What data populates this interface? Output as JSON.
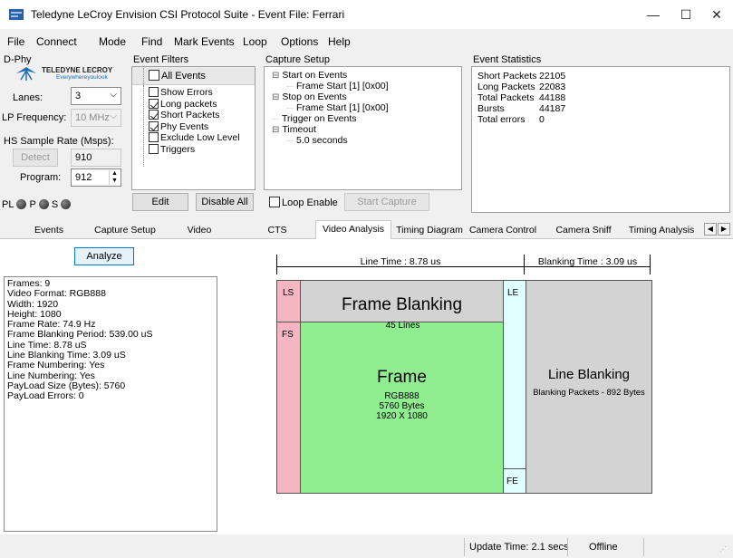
{
  "window": {
    "title": "Teledyne LeCroy Envision CSI Protocol Suite - Event File: Ferrari",
    "minimize": "—",
    "maximize": "☐",
    "close": "✕"
  },
  "menu": [
    "File",
    "Connect",
    "Mode",
    "Find",
    "Mark Events",
    "Loop",
    "Options",
    "Help"
  ],
  "dphy": {
    "group_label": "D-Phy",
    "logo_text": "TELEDYNE LECROY",
    "logo_tag": "Everywhereyoulook",
    "lanes_label": "Lanes:",
    "lanes_value": "3",
    "lp_label": "LP Frequency:",
    "lp_value": "10 MHz",
    "hs_label": "HS Sample Rate (Msps):",
    "detect_label": "Detect",
    "detect_value": "910",
    "program_label": "Program:",
    "program_value": "912",
    "pl_label": "PL",
    "p_label": "P",
    "s_label": "S"
  },
  "event_filters": {
    "group_label": "Event Filters",
    "all_events": "All Events",
    "items": [
      {
        "label": "Show Errors",
        "checked": false
      },
      {
        "label": "Long packets",
        "checked": true
      },
      {
        "label": "Short Packets",
        "checked": true
      },
      {
        "label": "Phy Events",
        "checked": true
      },
      {
        "label": "Exclude Low Level",
        "checked": false
      },
      {
        "label": "Triggers",
        "checked": false
      }
    ],
    "edit_label": "Edit",
    "disable_all_label": "Disable All"
  },
  "capture_setup": {
    "group_label": "Capture Setup",
    "tree": [
      {
        "label": "Start on Events",
        "level": 0,
        "expander": "⊟"
      },
      {
        "label": "Frame Start [1] [0x00]",
        "level": 1
      },
      {
        "label": "Stop on Events",
        "level": 0,
        "expander": "⊟"
      },
      {
        "label": "Frame Start [1] [0x00]",
        "level": 1
      },
      {
        "label": "Trigger on Events",
        "level": 0
      },
      {
        "label": "Timeout",
        "level": 0,
        "expander": "⊟"
      },
      {
        "label": "5.0 seconds",
        "level": 1
      }
    ],
    "loop_enable": "Loop Enable",
    "start_capture": "Start Capture"
  },
  "event_statistics": {
    "group_label": "Event Statistics",
    "rows": [
      {
        "name": "Short Packets",
        "value": "22105"
      },
      {
        "name": "Long Packets",
        "value": "22083"
      },
      {
        "name": "Total Packets",
        "value": "44188"
      },
      {
        "name": "Bursts",
        "value": "44187"
      },
      {
        "name": "Total errors",
        "value": "0"
      }
    ]
  },
  "tabs": [
    "Events",
    "Capture Setup",
    "Video",
    "CTS",
    "Video Analysis",
    "Timing Diagram",
    "Camera Control",
    "Camera Sniff",
    "Timing Analysis"
  ],
  "active_tab": "Video Analysis",
  "analyze_label": "Analyze",
  "video_info": [
    "Frames: 9",
    "Video Format: RGB888",
    "Width: 1920",
    "Height: 1080",
    "Frame Rate: 74.9 Hz",
    "Frame Blanking Period: 539.00 uS",
    "Line Time: 8.78 uS",
    "Line Blanking Time: 3.09 uS",
    "Frame Numbering: Yes",
    "Line Numbering: Yes",
    "PayLoad Size (Bytes): 5760",
    "PayLoad Errors: 0"
  ],
  "diagram": {
    "line_time": "Line Time : 8.78 us",
    "blanking_time": "Blanking Time : 3.09 us",
    "ls": "LS",
    "fs": "FS",
    "le": "LE",
    "fe": "FE",
    "frame_blanking": "Frame Blanking",
    "frame_blanking_lines": "45 Lines",
    "frame": "Frame",
    "format": "RGB888",
    "bytes": "5760 Bytes",
    "resolution": "1920 X 1080",
    "line_blanking": "Line Blanking",
    "blanking_packets": "Blanking Packets - 892 Bytes",
    "colors": {
      "pink": "#f4b6c2",
      "green": "#90ee90",
      "cyan": "#e0ffff",
      "gray": "#d3d3d3"
    }
  },
  "status": {
    "update_time": "Update Time: 2.1 secs",
    "state": "Offline"
  }
}
